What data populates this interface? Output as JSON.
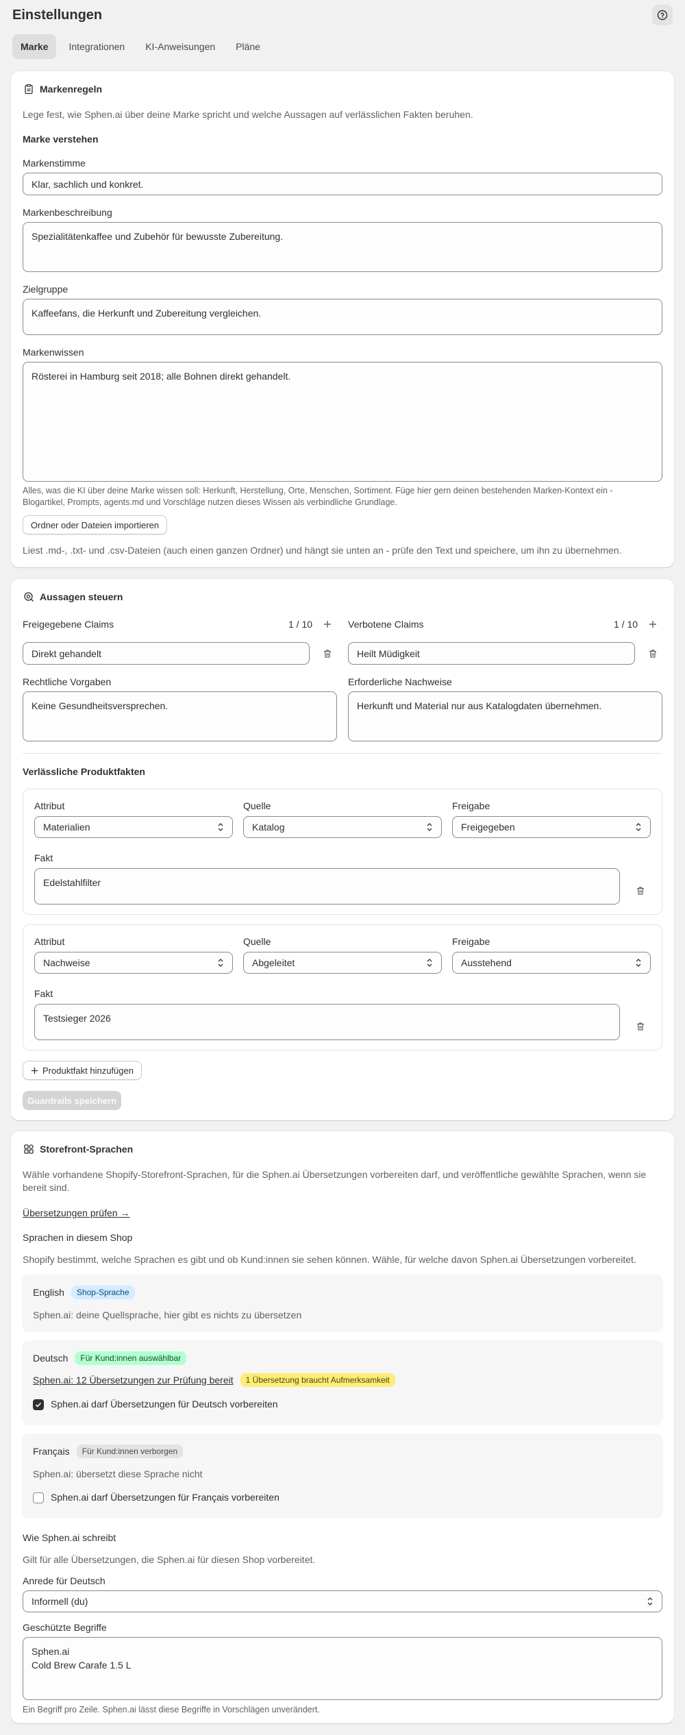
{
  "header": {
    "title": "Einstellungen"
  },
  "tabs": [
    {
      "label": "Marke",
      "active": true
    },
    {
      "label": "Integrationen",
      "active": false
    },
    {
      "label": "KI-Anweisungen",
      "active": false
    },
    {
      "label": "Pläne",
      "active": false
    }
  ],
  "brand": {
    "title": "Markenregeln",
    "intro": "Lege fest, wie Sphen.ai über deine Marke spricht und welche Aussagen auf verlässlichen Fakten beruhen.",
    "section": "Marke verstehen",
    "voice_label": "Markenstimme",
    "voice_value": "Klar, sachlich und konkret.",
    "desc_label": "Markenbeschreibung",
    "desc_value": "Spezialitätenkaffee und Zubehör für bewusste Zubereitung.",
    "audience_label": "Zielgruppe",
    "audience_value": "Kaffeefans, die Herkunft und Zubereitung vergleichen.",
    "knowledge_label": "Markenwissen",
    "knowledge_value": "Rösterei in Hamburg seit 2018; alle Bohnen direkt gehandelt.",
    "knowledge_help": "Alles, was die KI über deine Marke wissen soll: Herkunft, Herstellung, Orte, Menschen, Sortiment. Füge hier gern deinen bestehenden Marken-Kontext ein - Blogartikel, Prompts, agents.md und Vorschläge nutzen dieses Wissen als verbindliche Grundlage.",
    "import_button": "Ordner oder Dateien importieren",
    "import_help": "Liest .md-, .txt- und .csv-Dateien (auch einen ganzen Ordner) und hängt sie unten an - prüfe den Text und speichere, um ihn zu übernehmen."
  },
  "claims": {
    "title": "Aussagen steuern",
    "approved_label": "Freigegebene Claims",
    "approved_count": "1 / 10",
    "approved_value": "Direkt gehandelt",
    "forbidden_label": "Verbotene Claims",
    "forbidden_count": "1 / 10",
    "forbidden_value": "Heilt Müdigkeit",
    "legal_label": "Rechtliche Vorgaben",
    "legal_value": "Keine Gesundheitsversprechen.",
    "evidence_label": "Erforderliche Nachweise",
    "evidence_value": "Herkunft und Material nur aus Katalogdaten übernehmen.",
    "facts_title": "Verlässliche Produktfakten",
    "col_attribute": "Attribut",
    "col_source": "Quelle",
    "col_approval": "Freigabe",
    "fact_label": "Fakt",
    "facts": [
      {
        "attribute": "Materialien",
        "source": "Katalog",
        "approval": "Freigegeben",
        "fact": "Edelstahlfilter"
      },
      {
        "attribute": "Nachweise",
        "source": "Abgeleitet",
        "approval": "Ausstehend",
        "fact": "Testsieger 2026"
      }
    ],
    "add_fact_button": "Produktfakt hinzufügen",
    "save_button": "Guardrails speichern"
  },
  "languages": {
    "title": "Storefront-Sprachen",
    "intro": "Wähle vorhandene Shopify-Storefront-Sprachen, für die Sphen.ai Übersetzungen vorbereiten darf, und veröffentliche gewählte Sprachen, wenn sie bereit sind.",
    "review_link": "Übersetzungen prüfen →",
    "shop_languages_title": "Sprachen in diesem Shop",
    "shop_languages_help": "Shopify bestimmt, welche Sprachen es gibt und ob Kund:innen sie sehen können. Wähle, für welche davon Sphen.ai Übersetzungen vorbereitet.",
    "english": {
      "name": "English",
      "badge": "Shop-Sprache",
      "note": "Sphen.ai: deine Quellsprache, hier gibt es nichts zu übersetzen"
    },
    "german": {
      "name": "Deutsch",
      "badge": "Für Kund:innen auswählbar",
      "link": "Sphen.ai: 12 Übersetzungen zur Prüfung bereit",
      "warning": "1 Übersetzung braucht Aufmerksamkeit",
      "checkbox": "Sphen.ai darf Übersetzungen für Deutsch vorbereiten"
    },
    "french": {
      "name": "Français",
      "badge": "Für Kund:innen verborgen",
      "note": "Sphen.ai: übersetzt diese Sprache nicht",
      "checkbox": "Sphen.ai darf Übersetzungen für Français vorbereiten"
    },
    "writing_title": "Wie Sphen.ai schreibt",
    "writing_help": "Gilt für alle Übersetzungen, die Sphen.ai für diesen Shop vorbereitet.",
    "salutation_label": "Anrede für Deutsch",
    "salutation_value": "Informell (du)",
    "terms_label": "Geschützte Begriffe",
    "terms_value": "Sphen.ai\nCold Brew Carafe 1.5 L",
    "terms_help": "Ein Begriff pro Zeile. Sphen.ai lässt diese Begriffe in Vorschlägen unverändert."
  },
  "colors": {
    "badge_blue": "#d5ebff",
    "badge_green": "#b4fed2",
    "badge_gray": "#e3e3e3",
    "badge_yellow": "#ffeb78"
  }
}
